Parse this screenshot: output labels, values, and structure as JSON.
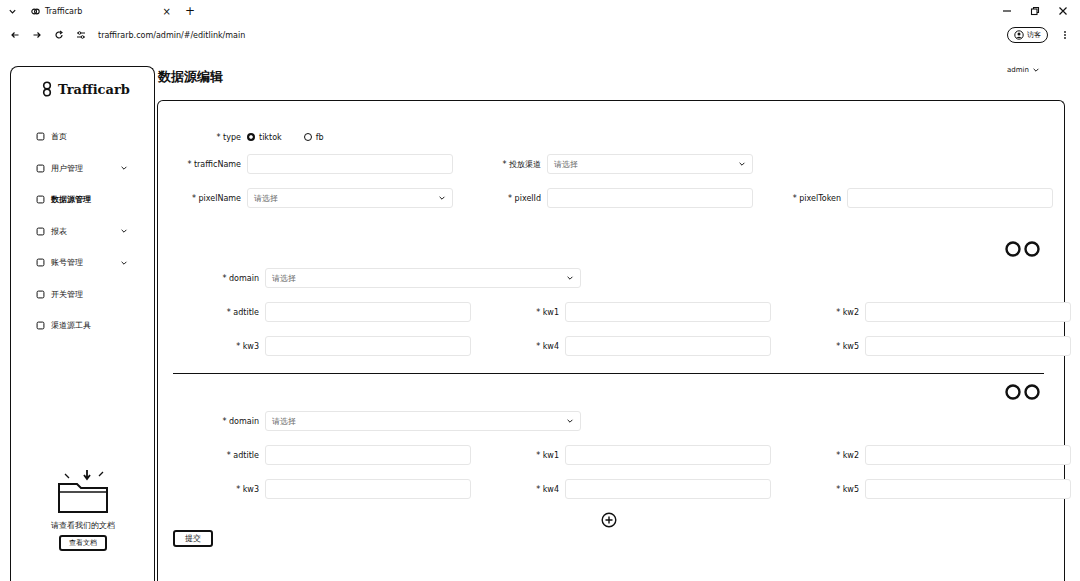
{
  "browser": {
    "tab_title": "Trafficarb",
    "tab_close": "×",
    "new_tab": "+",
    "url": "traffirarb.com/admin/#/editlink/main",
    "profile": "访客"
  },
  "sidebar": {
    "logo": "Trafficarb",
    "items": [
      {
        "label": "首页",
        "expandable": false,
        "selected": false
      },
      {
        "label": "用户管理",
        "expandable": true,
        "selected": false
      },
      {
        "label": "数据源管理",
        "expandable": false,
        "selected": true
      },
      {
        "label": "报表",
        "expandable": true,
        "selected": false
      },
      {
        "label": "账号管理",
        "expandable": true,
        "selected": false
      },
      {
        "label": "开关管理",
        "expandable": false,
        "selected": false
      },
      {
        "label": "渠道源工具",
        "expandable": false,
        "selected": false
      }
    ],
    "doc_text": "请查看我们的文档",
    "doc_button": "查看文档"
  },
  "header": {
    "title": "数据源编辑",
    "user": "admin"
  },
  "form": {
    "required_mark": "*",
    "type": {
      "label": "type",
      "options": [
        {
          "label": "tiktok",
          "selected": true
        },
        {
          "label": "fb",
          "selected": false
        }
      ]
    },
    "rows": [
      [
        {
          "label": "trafficName",
          "kind": "input",
          "placeholder": ""
        },
        {
          "label": "投放渠道",
          "kind": "select",
          "placeholder": "请选择"
        }
      ],
      [
        {
          "label": "pixelName",
          "kind": "select",
          "placeholder": "请选择"
        },
        {
          "label": "pixelId",
          "kind": "input",
          "placeholder": ""
        },
        {
          "label": "pixelToken",
          "kind": "input",
          "placeholder": ""
        }
      ]
    ],
    "groups": [
      {
        "domain": {
          "label": "domain",
          "placeholder": "请选择"
        },
        "fields": [
          "adtitle",
          "kw1",
          "kw2",
          "kw3",
          "kw4",
          "kw5"
        ]
      },
      {
        "domain": {
          "label": "domain",
          "placeholder": "请选择"
        },
        "fields": [
          "adtitle",
          "kw1",
          "kw2",
          "kw3",
          "kw4",
          "kw5"
        ]
      }
    ],
    "submit": "提交"
  }
}
